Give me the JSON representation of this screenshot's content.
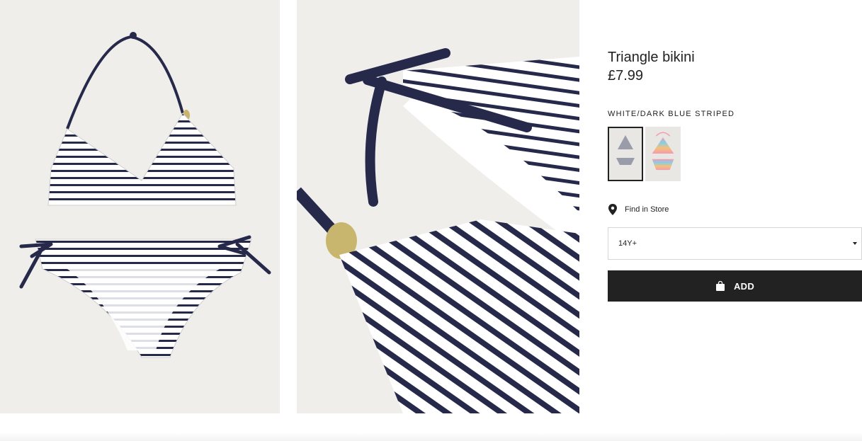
{
  "product": {
    "title": "Triangle bikini",
    "price": "£7.99",
    "color_name": "WHITE/DARK BLUE STRIPED"
  },
  "images": [
    {
      "name": "bikini-full-view",
      "icon": "striped-bikini-flat-lay"
    },
    {
      "name": "bikini-detail-view",
      "icon": "striped-bikini-shell-detail"
    }
  ],
  "swatches": [
    {
      "name": "white-dark-blue-striped",
      "selected": true
    },
    {
      "name": "multicolour-zigzag",
      "selected": false
    }
  ],
  "store": {
    "label": "Find in Store",
    "icon": "location-pin-icon"
  },
  "size_select": {
    "value": "14Y+",
    "icon": "chevron-down-icon"
  },
  "add_button": {
    "label": "ADD",
    "icon": "shopping-bag-icon"
  },
  "colors": {
    "navy": "#26294a",
    "button": "#222222",
    "photo_bg": "#efeeeb"
  }
}
